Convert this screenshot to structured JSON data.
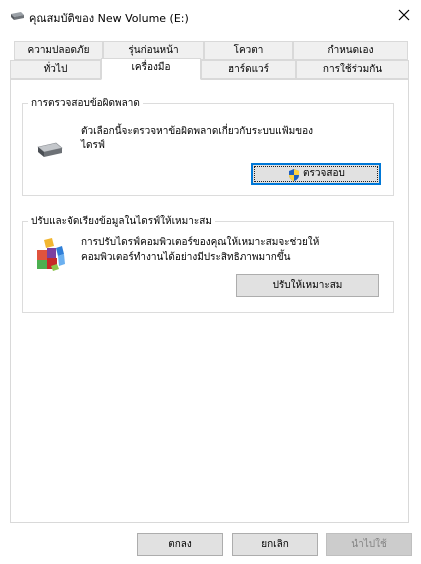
{
  "window": {
    "title": "คุณสมบัติของ New Volume (E:)",
    "title_icon": "drive-icon",
    "close_icon": "close-icon"
  },
  "tabs": {
    "row1": [
      "ความปลอดภัย",
      "รุ่นก่อนหน้า",
      "โควตา",
      "กำหนดเอง"
    ],
    "row2": [
      "ทั่วไป",
      "เครื่องมือ",
      "ฮาร์ดแวร์",
      "การใช้ร่วมกัน"
    ],
    "active": "เครื่องมือ"
  },
  "error_checking": {
    "title": "การตรวจสอบข้อผิดพลาด",
    "description_line1": "ตัวเลือกนี้จะตรวจหาข้อผิดพลาดเกี่ยวกับระบบแฟ้มของ",
    "description_line2": "ไดรฟ์",
    "icon": "drive-icon",
    "button_label": "ตรวจสอบ",
    "button_icon": "shield-icon"
  },
  "optimize": {
    "title": "ปรับและจัดเรียงข้อมูลในไดรฟ์ให้เหมาะสม",
    "description_line1": "การปรับไดรฟ์คอมพิวเตอร์ของคุณให้เหมาะสมจะช่วยให้",
    "description_line2": "คอมพิวเตอร์ทำงานได้อย่างมีประสิทธิภาพมากขึ้น",
    "icon": "defrag-icon",
    "button_label": "ปรับให้เหมาะสม"
  },
  "footer": {
    "ok_label": "ตกลง",
    "cancel_label": "ยกเลิก",
    "apply_label": "นำไปใช้"
  }
}
